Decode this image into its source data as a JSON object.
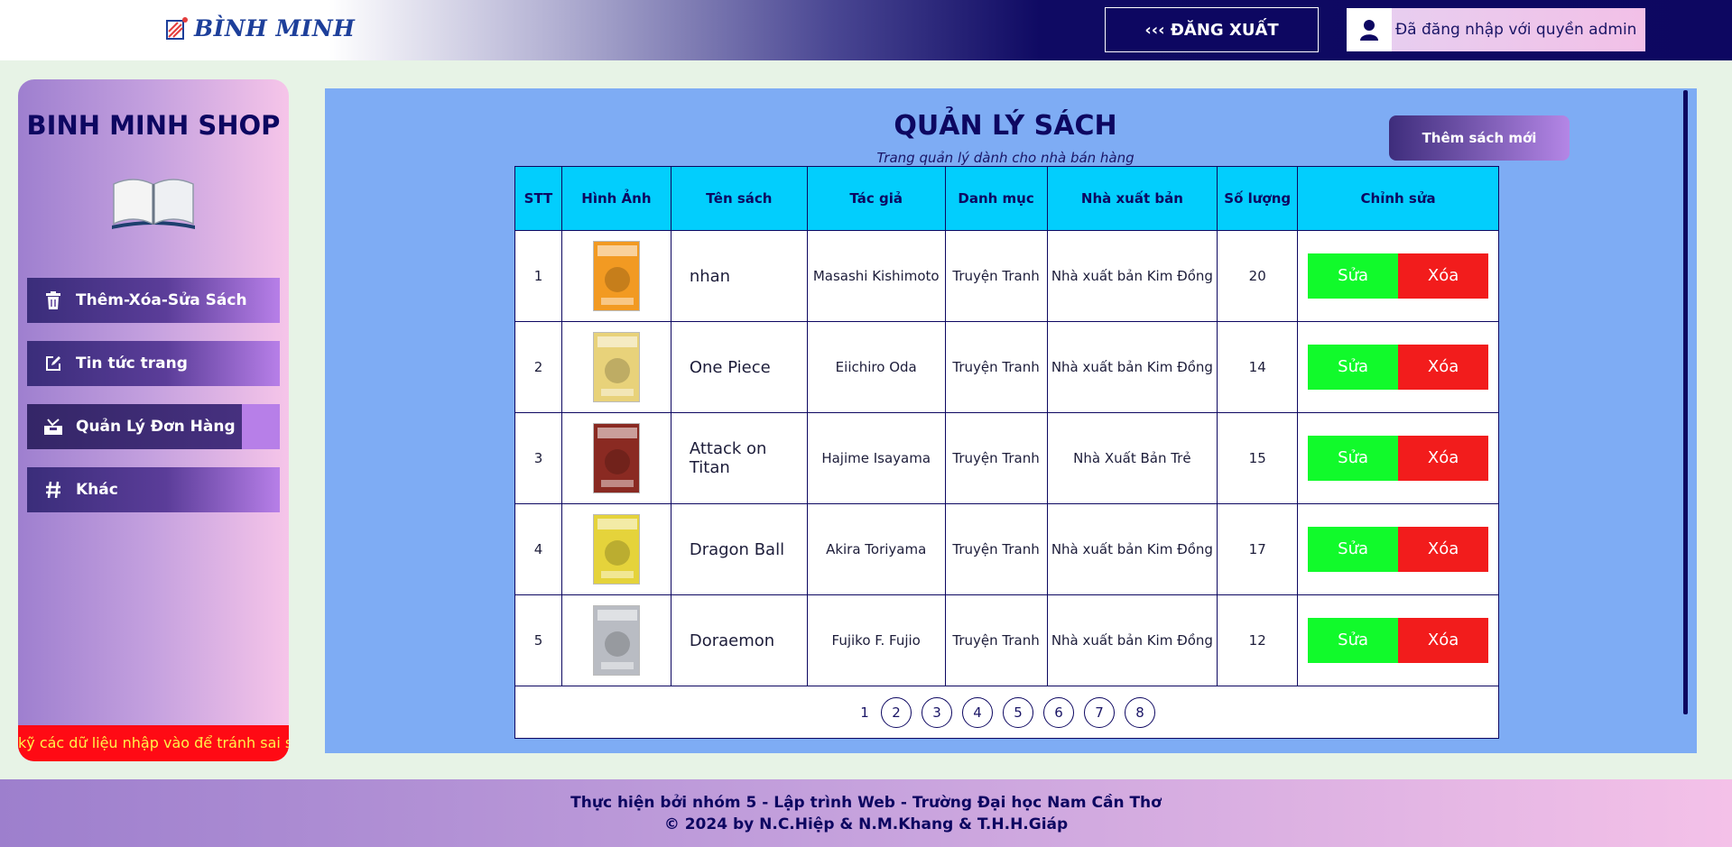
{
  "header": {
    "logo_text": "BÌNH MINH",
    "logout_label": "‹‹‹ ĐĂNG XUẤT",
    "admin_label": "Đã đăng nhập với quyền admin"
  },
  "sidebar": {
    "title": "BINH MINH SHOP",
    "items": [
      {
        "label": "Thêm-Xóa-Sửa Sách",
        "icon": "trash-icon"
      },
      {
        "label": "Tin tức trang",
        "icon": "edit-icon"
      },
      {
        "label": "Quản Lý Đơn Hàng",
        "icon": "inbox-icon"
      },
      {
        "label": "Khác",
        "icon": "hashtag-icon"
      }
    ],
    "marquee": "kỹ các dữ liệu nhập vào để tránh sai sót"
  },
  "main": {
    "title": "QUẢN LÝ SÁCH",
    "subtitle": "Trang quản lý dành cho nhà bán hàng",
    "add_button": "Thêm sách mới",
    "columns": [
      "STT",
      "Hình Ảnh",
      "Tên sách",
      "Tác giả",
      "Danh mục",
      "Nhà xuất bản",
      "Số lượng",
      "Chỉnh sửa"
    ],
    "rows": [
      {
        "stt": "1",
        "name": "nhan",
        "author": "Masashi Kishimoto",
        "category": "Truyện Tranh",
        "publisher": "Nhà xuất bản Kim Đồng",
        "qty": "20",
        "cover_color": "#f29a22"
      },
      {
        "stt": "2",
        "name": "One Piece",
        "author": "Eiichiro Oda",
        "category": "Truyện Tranh",
        "publisher": "Nhà xuất bản Kim Đồng",
        "qty": "14",
        "cover_color": "#e8d27a"
      },
      {
        "stt": "3",
        "name": "Attack on Titan",
        "author": "Hajime Isayama",
        "category": "Truyện Tranh",
        "publisher": "Nhà Xuất Bản Trẻ",
        "qty": "15",
        "cover_color": "#8a2a22"
      },
      {
        "stt": "4",
        "name": "Dragon Ball",
        "author": "Akira Toriyama",
        "category": "Truyện Tranh",
        "publisher": "Nhà xuất bản Kim Đồng",
        "qty": "17",
        "cover_color": "#e5d33b"
      },
      {
        "stt": "5",
        "name": "Doraemon",
        "author": "Fujiko F. Fujio",
        "category": "Truyện Tranh",
        "publisher": "Nhà xuất bản Kim Đồng",
        "qty": "12",
        "cover_color": "#b9bcc3"
      }
    ],
    "edit_label": "Sửa",
    "delete_label": "Xóa",
    "pages": [
      "1",
      "2",
      "3",
      "4",
      "5",
      "6",
      "7",
      "8"
    ]
  },
  "footer": {
    "line1": "Thực hiện bởi nhóm 5 - Lập trình Web - Trường Đại học Nam Cần Thơ",
    "line2": "© 2024 by N.C.Hiệp & N.M.Khang & T.H.H.Giáp"
  },
  "colors": {
    "navy": "#0d0761",
    "main_bg": "#7eacf4",
    "header_cyan": "#02cefd",
    "edit_green": "#11fa2b",
    "delete_red": "#f21c1c"
  }
}
